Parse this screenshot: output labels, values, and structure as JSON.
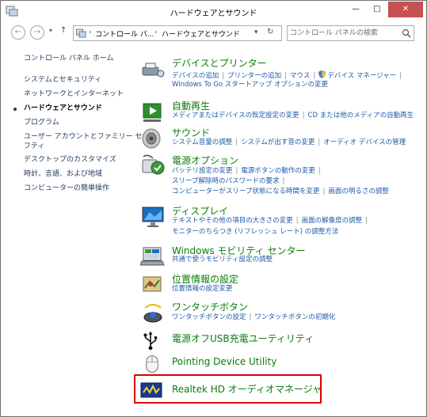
{
  "window": {
    "title": "ハードウェアとサウンド",
    "minimize": "—",
    "maximize": "□",
    "close": "✕"
  },
  "navbar": {
    "breadcrumb": [
      "コントロール パ...",
      "ハードウェアとサウンド"
    ],
    "search_placeholder": "コントロール パネルの検索"
  },
  "sidebar": {
    "items": [
      {
        "label": "コントロール パネル ホーム"
      },
      {
        "label": "システムとセキュリティ"
      },
      {
        "label": "ネットワークとインターネット"
      },
      {
        "label": "ハードウェアとサウンド"
      },
      {
        "label": "プログラム"
      },
      {
        "label": "ユーザー アカウントとファミリー セー"
      },
      {
        "label": "フティ"
      },
      {
        "label": "デスクトップのカスタマイズ"
      },
      {
        "label": "時計、言語、および地域"
      },
      {
        "label": "コンピューターの簡単操作"
      }
    ]
  },
  "categories": [
    {
      "title": "デバイスとプリンター",
      "lines": [
        [
          "デバイスの追加",
          "プリンターの追加",
          "マウス",
          "デバイス マネージャー"
        ],
        [
          "Windows To Go スタートアップ オプションの変更"
        ]
      ]
    },
    {
      "title": "自動再生",
      "lines": [
        [
          "メディアまたはデバイスの既定設定の変更",
          "CD または他のメディアの自動再生"
        ]
      ]
    },
    {
      "title": "サウンド",
      "lines": [
        [
          "システム音量の調整",
          "システムが出す音の変更",
          "オーディオ デバイスの管理"
        ]
      ]
    },
    {
      "title": "電源オプション",
      "lines": [
        [
          "バッテリ設定の変更",
          "電源ボタンの動作の変更"
        ],
        [
          "スリープ解除時のパスワードの要求"
        ],
        [
          "コンピューターがスリープ状態になる時間を変更",
          "画面の明るさの調整"
        ]
      ]
    },
    {
      "title": "ディスプレイ",
      "lines": [
        [
          "テキストやその他の項目の大きさの変更",
          "画面の解像度の調整"
        ],
        [
          "モニターのちらつき (リフレッシュ レート) の調整方法"
        ]
      ]
    },
    {
      "title": "Windows モビリティ センター",
      "lines": [
        [
          "共通で使うモビリティ設定の調整"
        ]
      ]
    },
    {
      "title": "位置情報の設定",
      "lines": [
        [
          "位置情報の設定変更"
        ]
      ]
    },
    {
      "title": "ワンタッチボタン",
      "lines": [
        [
          "ワンタッチボタンの設定",
          "ワンタッチボタンの初期化"
        ]
      ]
    },
    {
      "title": "電源オフUSB充電ユーティリティ",
      "lines": []
    },
    {
      "title": "Pointing Device Utility",
      "lines": []
    },
    {
      "title": "Realtek HD オーディオマネージャ",
      "lines": []
    }
  ],
  "colors": {
    "link": "#1e5aa8",
    "category_title": "#0a7c0a",
    "highlight": "#e00000"
  }
}
